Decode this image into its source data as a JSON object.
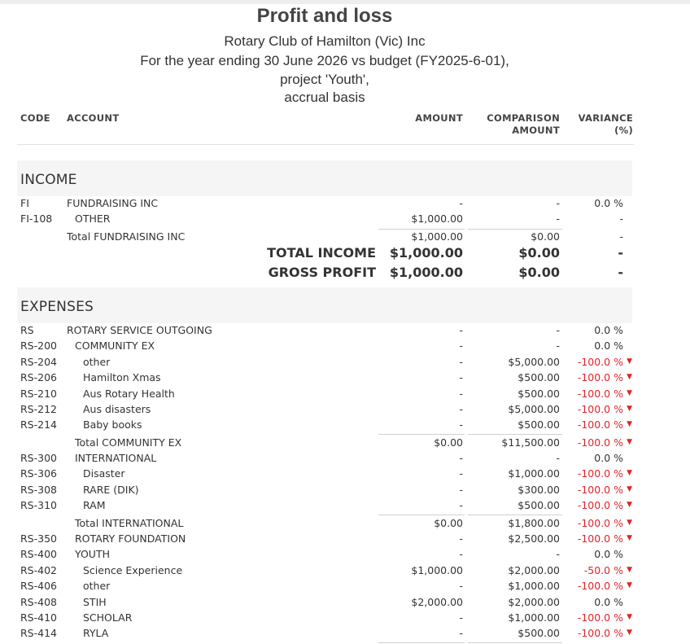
{
  "report": {
    "title": "Profit and loss",
    "org": "Rotary Club of Hamilton (Vic) Inc",
    "period": "For the year ending 30 June 2026 vs budget (FY2025-6-01),",
    "project": "project 'Youth',",
    "basis": "accrual basis"
  },
  "columns": {
    "code": "CODE",
    "account": "ACCOUNT",
    "amount": "AMOUNT",
    "comparison_1": "COMPARISON",
    "comparison_2": "AMOUNT",
    "variance_1": "VARIANCE",
    "variance_2": "(%)"
  },
  "income": {
    "heading": "INCOME",
    "rows": [
      {
        "code": "FI",
        "account": "FUNDRAISING INC",
        "amount": "-",
        "comparison": "-",
        "variance": "0.0 %"
      },
      {
        "code": "FI-108",
        "account": "OTHER",
        "amount": "$1,000.00",
        "comparison": "-",
        "variance": "-"
      },
      {
        "code": "",
        "account": "Total FUNDRAISING INC",
        "amount": "$1,000.00",
        "comparison": "$0.00",
        "variance": "-"
      }
    ],
    "total_income": {
      "label": "TOTAL INCOME",
      "amount": "$1,000.00",
      "comparison": "$0.00",
      "variance": "-"
    },
    "gross_profit": {
      "label": "GROSS PROFIT",
      "amount": "$1,000.00",
      "comparison": "$0.00",
      "variance": "-"
    }
  },
  "expenses": {
    "heading": "EXPENSES",
    "rows": [
      {
        "code": "RS",
        "account": "ROTARY SERVICE OUTGOING",
        "amount": "-",
        "comparison": "-",
        "variance": "0.0 %"
      },
      {
        "code": "RS-200",
        "account": "COMMUNITY EX",
        "amount": "-",
        "comparison": "-",
        "variance": "0.0 %"
      },
      {
        "code": "RS-204",
        "account": "other",
        "amount": "-",
        "comparison": "$5,000.00",
        "variance": "-100.0 %"
      },
      {
        "code": "RS-206",
        "account": "Hamilton Xmas",
        "amount": "-",
        "comparison": "$500.00",
        "variance": "-100.0 %"
      },
      {
        "code": "RS-210",
        "account": "Aus Rotary Health",
        "amount": "-",
        "comparison": "$500.00",
        "variance": "-100.0 %"
      },
      {
        "code": "RS-212",
        "account": "Aus disasters",
        "amount": "-",
        "comparison": "$5,000.00",
        "variance": "-100.0 %"
      },
      {
        "code": "RS-214",
        "account": "Baby books",
        "amount": "-",
        "comparison": "$500.00",
        "variance": "-100.0 %"
      },
      {
        "code": "",
        "account": "Total COMMUNITY EX",
        "amount": "$0.00",
        "comparison": "$11,500.00",
        "variance": "-100.0 %"
      },
      {
        "code": "RS-300",
        "account": "INTERNATIONAL",
        "amount": "-",
        "comparison": "-",
        "variance": "0.0 %"
      },
      {
        "code": "RS-306",
        "account": "Disaster",
        "amount": "-",
        "comparison": "$1,000.00",
        "variance": "-100.0 %"
      },
      {
        "code": "RS-308",
        "account": "RARE (DIK)",
        "amount": "-",
        "comparison": "$300.00",
        "variance": "-100.0 %"
      },
      {
        "code": "RS-310",
        "account": "RAM",
        "amount": "-",
        "comparison": "$500.00",
        "variance": "-100.0 %"
      },
      {
        "code": "",
        "account": "Total INTERNATIONAL",
        "amount": "$0.00",
        "comparison": "$1,800.00",
        "variance": "-100.0 %"
      },
      {
        "code": "RS-350",
        "account": "ROTARY FOUNDATION",
        "amount": "-",
        "comparison": "$2,500.00",
        "variance": "-100.0 %"
      },
      {
        "code": "RS-400",
        "account": "YOUTH",
        "amount": "-",
        "comparison": "-",
        "variance": "0.0 %"
      },
      {
        "code": "RS-402",
        "account": "Science Experience",
        "amount": "$1,000.00",
        "comparison": "$2,000.00",
        "variance": "-50.0 %"
      },
      {
        "code": "RS-406",
        "account": "other",
        "amount": "-",
        "comparison": "$1,000.00",
        "variance": "-100.0 %"
      },
      {
        "code": "RS-408",
        "account": "STIH",
        "amount": "$2,000.00",
        "comparison": "$2,000.00",
        "variance": "0.0 %"
      },
      {
        "code": "RS-410",
        "account": "SCHOLAR",
        "amount": "-",
        "comparison": "$1,000.00",
        "variance": "-100.0 %"
      },
      {
        "code": "RS-414",
        "account": "RYLA",
        "amount": "-",
        "comparison": "$500.00",
        "variance": "-100.0 %"
      }
    ]
  },
  "colors": {
    "negative": "#e0242b",
    "section_bg": "#f4f5f4"
  },
  "icons": {
    "negative_variance": "down-triangle-icon"
  }
}
